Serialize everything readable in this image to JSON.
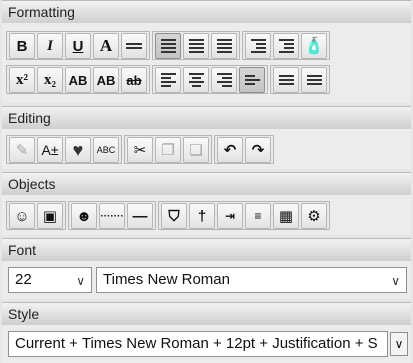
{
  "formatting": {
    "title": "Formatting",
    "bold": "B",
    "italic": "I",
    "underline": "U",
    "font_a": "A",
    "superscript": "x²",
    "subscript": "x₂",
    "allcaps": "AB",
    "smallcaps": "AB",
    "strike": "ab"
  },
  "editing": {
    "title": "Editing",
    "font_size": "A±",
    "spell": "ABC"
  },
  "objects": {
    "title": "Objects"
  },
  "font": {
    "title": "Font",
    "size_value": "22",
    "family_value": "Times New Roman"
  },
  "style": {
    "title": "Style",
    "value": "Current + Times New Roman + 12pt + Justification + S"
  }
}
